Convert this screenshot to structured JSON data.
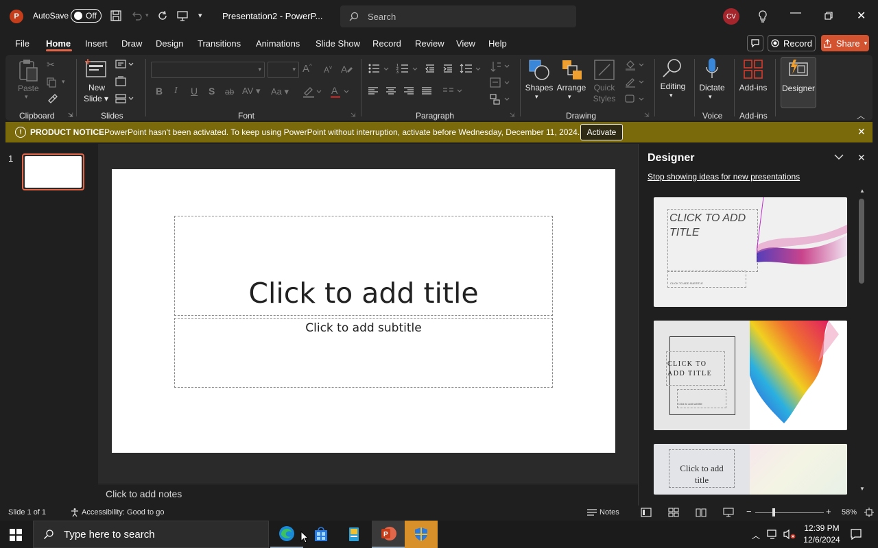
{
  "titlebar": {
    "logo_letter": "P",
    "autosave_label": "AutoSave",
    "autosave_state": "Off",
    "doc_title": "Presentation2 - PowerP...",
    "search_placeholder": "Search",
    "avatar_initials": "CV"
  },
  "tabs": [
    "File",
    "Home",
    "Insert",
    "Draw",
    "Design",
    "Transitions",
    "Animations",
    "Slide Show",
    "Record",
    "Review",
    "View",
    "Help"
  ],
  "active_tab": "Home",
  "record_label": "Record",
  "share_label": "Share",
  "ribbon": {
    "clipboard": {
      "paste": "Paste",
      "label": "Clipboard"
    },
    "slides": {
      "new_slide_1": "New",
      "new_slide_2": "Slide",
      "label": "Slides"
    },
    "font": {
      "label": "Font",
      "bold": "B",
      "italic": "I",
      "underline": "U",
      "strike": "S",
      "strike2": "ab",
      "spacing": "AV",
      "case": "Aa",
      "grow": "A",
      "shrink": "A",
      "color": "A"
    },
    "paragraph": {
      "label": "Paragraph"
    },
    "drawing": {
      "shapes": "Shapes",
      "arrange": "Arrange",
      "quick_styles_1": "Quick",
      "quick_styles_2": "Styles",
      "label": "Drawing"
    },
    "editing": {
      "label_btn": "Editing"
    },
    "voice": {
      "dictate": "Dictate",
      "label": "Voice"
    },
    "addins": {
      "addins_btn": "Add-ins",
      "label": "Add-ins"
    },
    "designer": {
      "designer_btn": "Designer"
    }
  },
  "notice": {
    "title": "PRODUCT NOTICE",
    "text": "PowerPoint hasn't been activated. To keep using PowerPoint without interruption, activate before Wednesday, December 11, 2024.",
    "button": "Activate"
  },
  "thumbnails": [
    {
      "number": "1"
    }
  ],
  "slide": {
    "title_placeholder": "Click to add title",
    "subtitle_placeholder": "Click to add subtitle"
  },
  "notes_placeholder": "Click to add notes",
  "designer_pane": {
    "title": "Designer",
    "stop_link": "Stop showing ideas for new presentations",
    "cards": [
      {
        "title": "CLICK TO ADD TITLE",
        "subtitle": "CLICK TO ADD SUBTITLE"
      },
      {
        "title_1": "CLICK TO",
        "title_2": "ADD TITLE",
        "subtitle": "Click to add subtitle"
      },
      {
        "title_1": "Click to add",
        "title_2": "title"
      }
    ]
  },
  "status": {
    "slide_info": "Slide 1 of 1",
    "accessibility": "Accessibility: Good to go",
    "notes": "Notes",
    "zoom": "58%"
  },
  "taskbar": {
    "search_placeholder": "Type here to search",
    "time": "12:39 PM",
    "date": "12/6/2024"
  },
  "colors": {
    "accent": "#d35230",
    "notice_bg": "#7a6a0b",
    "ribbon_bg": "#292929"
  }
}
